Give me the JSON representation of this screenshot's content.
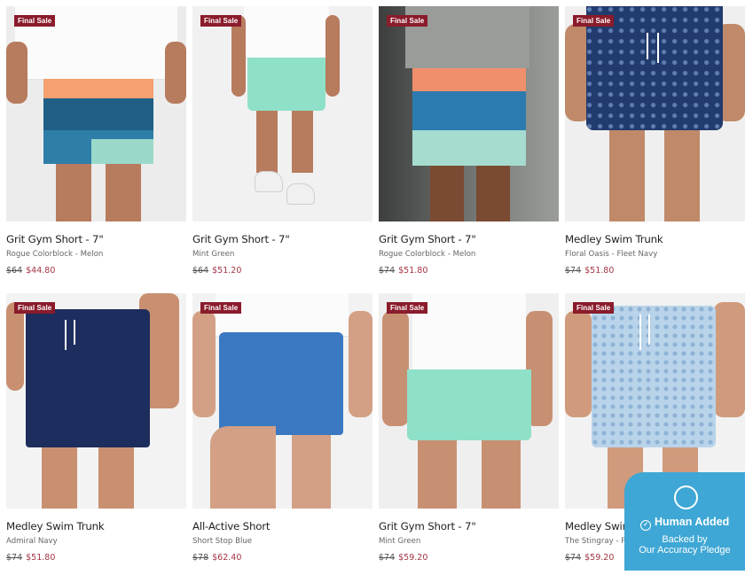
{
  "products": [
    {
      "badge": "Final Sale",
      "name": "Grit Gym Short - 7\"",
      "variant": "Rogue Colorblock - Melon",
      "old_price": "$64",
      "new_price": "$44.80"
    },
    {
      "badge": "Final Sale",
      "name": "Grit Gym Short - 7\"",
      "variant": "Mint Green",
      "old_price": "$64",
      "new_price": "$51.20"
    },
    {
      "badge": "Final Sale",
      "name": "Grit Gym Short - 7\"",
      "variant": "Rogue Colorblock - Melon",
      "old_price": "$74",
      "new_price": "$51.80"
    },
    {
      "badge": "Final Sale",
      "name": "Medley Swim Trunk",
      "variant": "Floral Oasis - Fleet Navy",
      "old_price": "$74",
      "new_price": "$51.80"
    },
    {
      "badge": "Final Sale",
      "name": "Medley Swim Trunk",
      "variant": "Admiral Navy",
      "old_price": "$74",
      "new_price": "$51.80"
    },
    {
      "badge": "Final Sale",
      "name": "All-Active Short",
      "variant": "Short Stop Blue",
      "old_price": "$78",
      "new_price": "$62.40"
    },
    {
      "badge": "Final Sale",
      "name": "Grit Gym Short - 7\"",
      "variant": "Mint Green",
      "old_price": "$74",
      "new_price": "$59.20"
    },
    {
      "badge": "Final Sale",
      "name": "Medley Swim Trunk",
      "variant": "The Stingray - Pale Blue",
      "old_price": "$74",
      "new_price": "$59.20"
    }
  ],
  "widget": {
    "title": "Human Added",
    "line1": "Backed by",
    "line2": "Our Accuracy Pledge"
  },
  "colors": {
    "badge_bg": "#8a1c2b",
    "sale_price": "#a23442",
    "widget_bg": "#3ea7d5"
  }
}
